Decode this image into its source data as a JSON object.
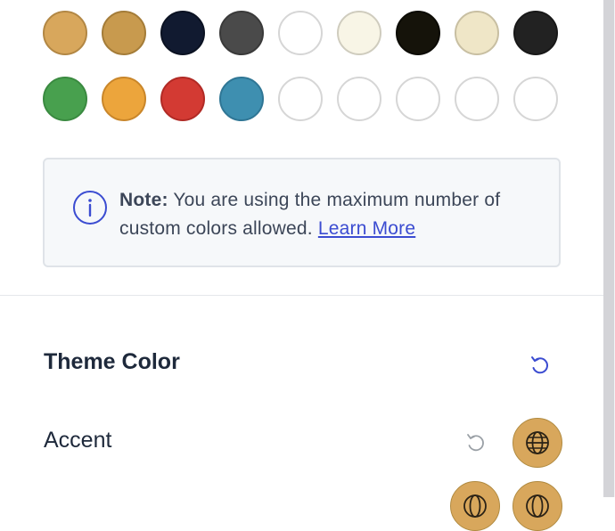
{
  "palette": {
    "row1": [
      {
        "color": "#d8a75c",
        "border": "#b28744"
      },
      {
        "color": "#c89a4e",
        "border": "#a47c38"
      },
      {
        "color": "#111a30",
        "border": "#0b1222"
      },
      {
        "color": "#4a4a4a",
        "border": "#3a3a3a"
      },
      {
        "color": "#ffffff",
        "border": "#d6d6d6"
      },
      {
        "color": "#f8f5e6",
        "border": "#cfccbe"
      },
      {
        "color": "#15130a",
        "border": "#0c0b05"
      },
      {
        "color": "#efe6c7",
        "border": "#c8bfa2"
      },
      {
        "color": "#222222",
        "border": "#181818"
      }
    ],
    "row2": [
      {
        "color": "#48a04e",
        "border": "#3a8a40"
      },
      {
        "color": "#eca53c",
        "border": "#c9862a"
      },
      {
        "color": "#d33a33",
        "border": "#b12a25"
      },
      {
        "color": "#3e8fb0",
        "border": "#2f7695"
      },
      {
        "color": "#ffffff",
        "border": "#d6d6d6"
      },
      {
        "color": "#ffffff",
        "border": "#d6d6d6"
      },
      {
        "color": "#ffffff",
        "border": "#d6d6d6"
      },
      {
        "color": "#ffffff",
        "border": "#d6d6d6"
      },
      {
        "color": "#ffffff",
        "border": "#d6d6d6"
      }
    ]
  },
  "notice": {
    "label": "Note:",
    "message": " You are using the maximum number of custom colors allowed. ",
    "link": "Learn More",
    "icon": "info-icon"
  },
  "theme": {
    "title": "Theme Color",
    "reset_icon": "reset-icon",
    "accent_label": "Accent",
    "accent_color": "#d8a75c",
    "accent_icon": "globe-icon"
  },
  "colors": {
    "link": "#3b4cd1",
    "reset_active": "#3b4cd1",
    "reset_inactive": "#9aa0a6"
  }
}
